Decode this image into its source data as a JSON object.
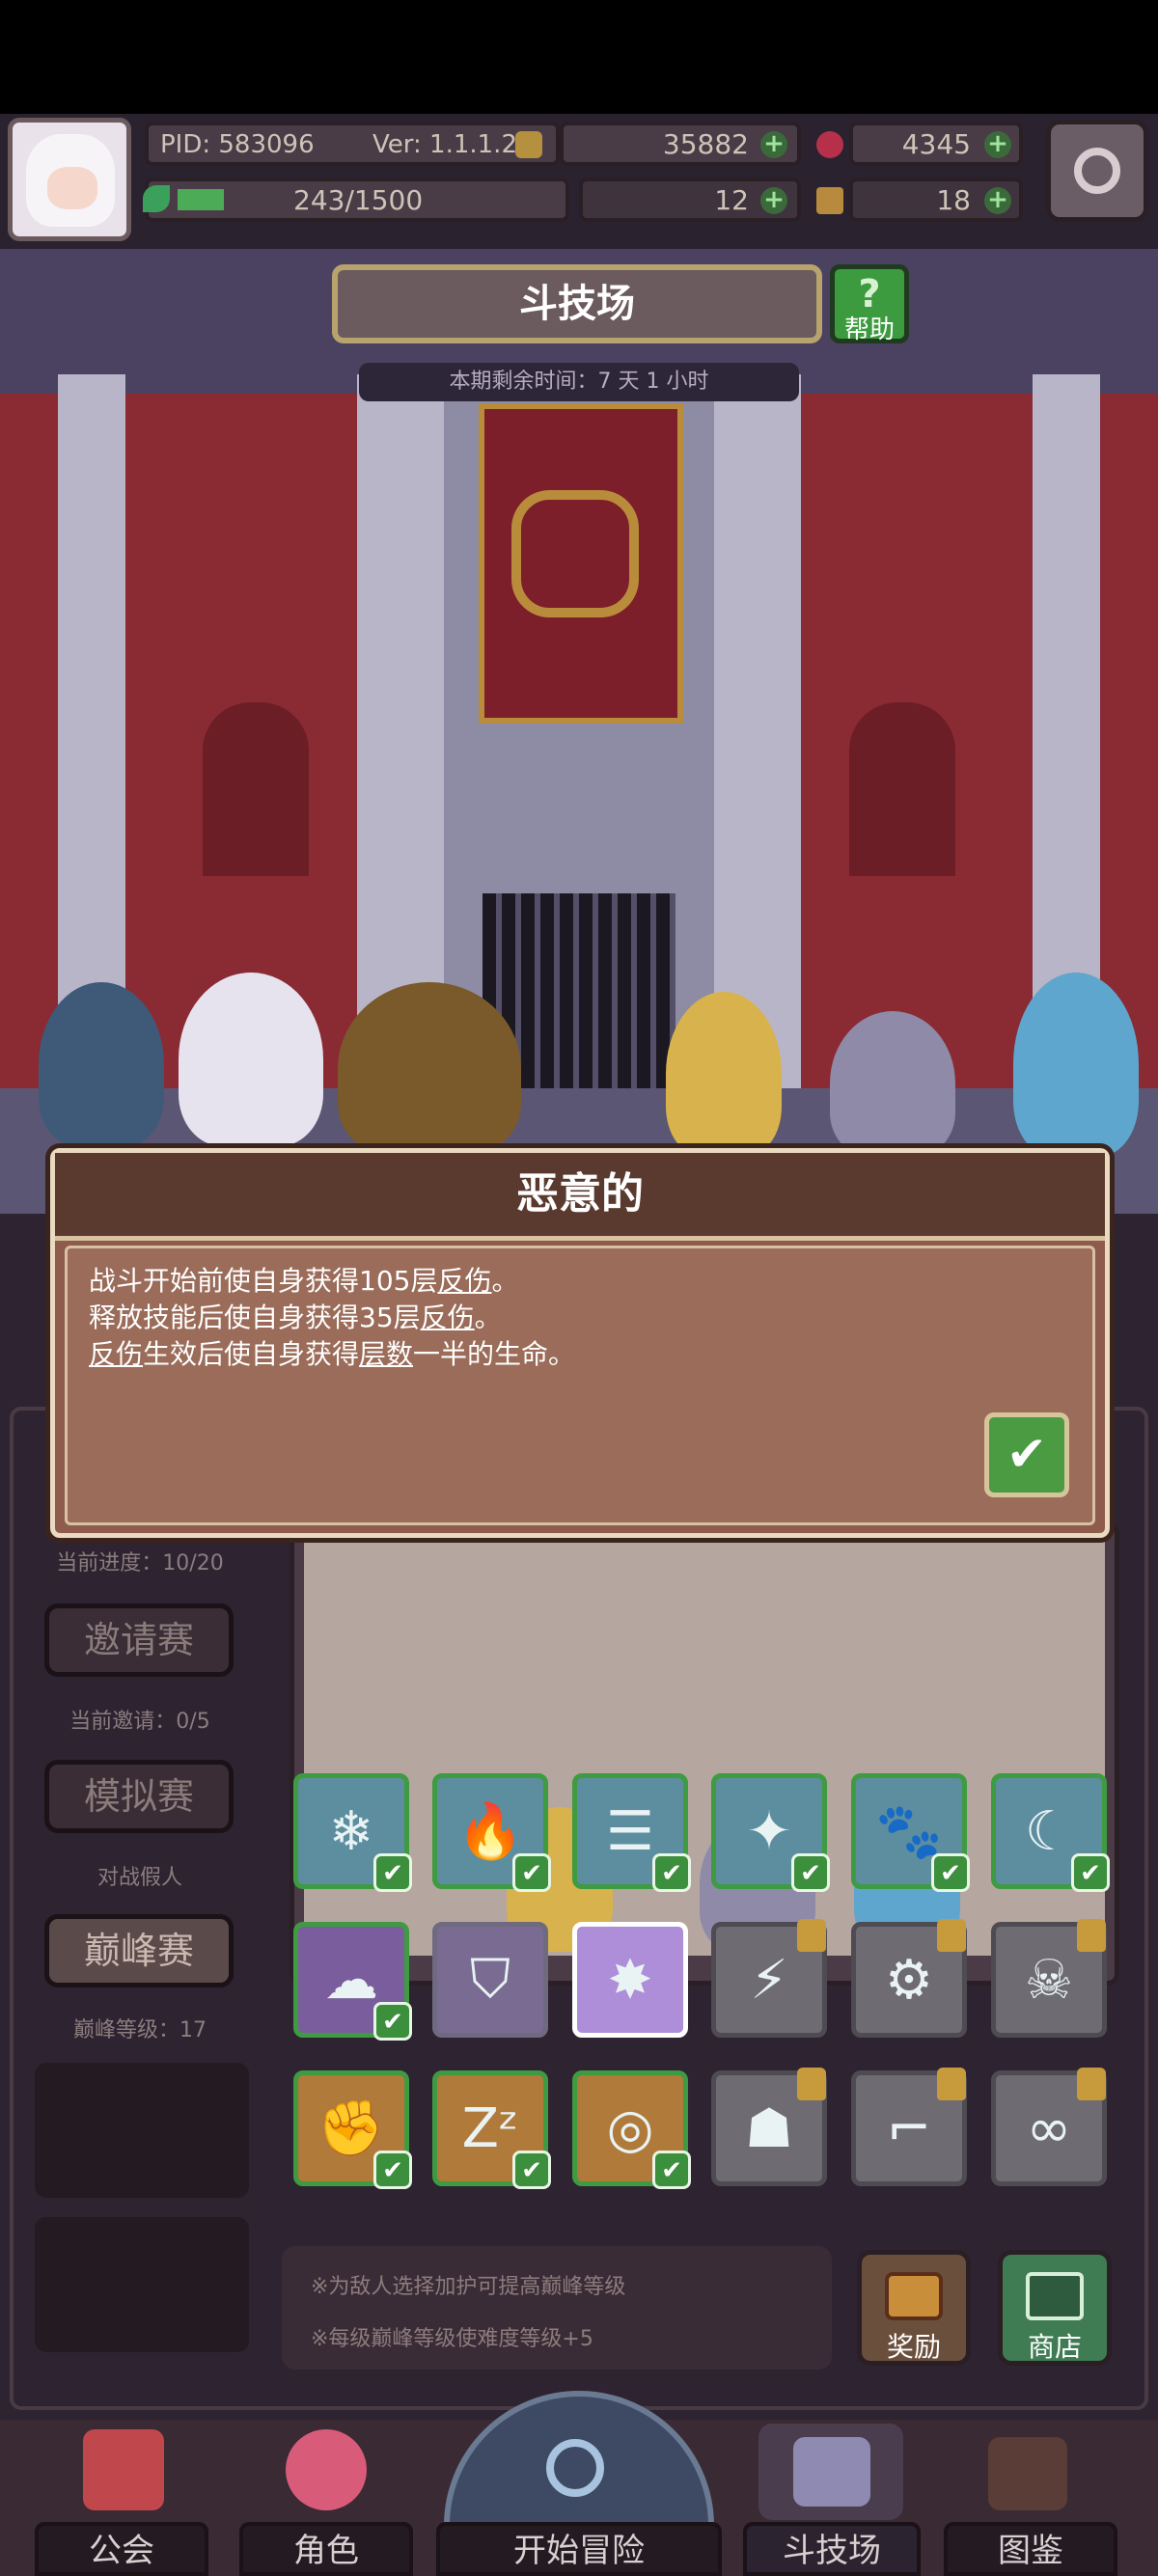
{
  "top_bar": {
    "pid": "PID: 583096",
    "version": "Ver: 1.1.1.2",
    "gold": "35882",
    "gems": "4345",
    "stamina": "243/1500",
    "clover": "12",
    "keys": "18"
  },
  "page": {
    "title": "斗技场",
    "help_label": "帮助",
    "remaining_time": "本期剩余时间：7 天 1 小时"
  },
  "sidebar": {
    "progress_text": "当前进度：10/20",
    "invite_button": "邀请赛",
    "invite_count": "当前邀请：0/5",
    "mock_button": "模拟赛",
    "mock_sub": "对战假人",
    "peak_button": "巅峰赛",
    "peak_level": "巅峰等级：17"
  },
  "tiles": [
    {
      "icon": "snowflake-icon",
      "glyph": "❄",
      "style": "blue",
      "state": "checked"
    },
    {
      "icon": "flame-icon",
      "glyph": "🔥",
      "style": "blue",
      "state": "checked"
    },
    {
      "icon": "funnel-icon",
      "glyph": "☰",
      "style": "blue",
      "state": "checked"
    },
    {
      "icon": "sparkle-icon",
      "glyph": "✦",
      "style": "blue",
      "state": "checked"
    },
    {
      "icon": "paw-icon",
      "glyph": "🐾",
      "style": "blue",
      "state": "checked"
    },
    {
      "icon": "claw-icon",
      "glyph": "☾",
      "style": "blue",
      "state": "checked"
    },
    {
      "icon": "mushroom-cloud-icon",
      "glyph": "☁",
      "style": "purple",
      "state": "checked"
    },
    {
      "icon": "shield-emblem-icon",
      "glyph": "⛉",
      "style": "purple2",
      "state": "none"
    },
    {
      "icon": "burst-icon",
      "glyph": "✸",
      "style": "sel",
      "state": "selected"
    },
    {
      "icon": "lightning-icon",
      "glyph": "⚡",
      "style": "gray",
      "state": "locked"
    },
    {
      "icon": "gear-ring-icon",
      "glyph": "⚙",
      "style": "gray",
      "state": "locked"
    },
    {
      "icon": "skull-icon",
      "glyph": "☠",
      "style": "gray",
      "state": "locked"
    },
    {
      "icon": "fist-icon",
      "glyph": "✊",
      "style": "orange",
      "state": "checked"
    },
    {
      "icon": "sleep-icon",
      "glyph": "Zᶻ",
      "style": "orange",
      "state": "checked"
    },
    {
      "icon": "ripple-icon",
      "glyph": "◎",
      "style": "orange",
      "state": "checked"
    },
    {
      "icon": "ghost-icon",
      "glyph": "☗",
      "style": "gray",
      "state": "locked"
    },
    {
      "icon": "scythe-icon",
      "glyph": "⌐",
      "style": "gray",
      "state": "locked"
    },
    {
      "icon": "infinity-icon",
      "glyph": "∞",
      "style": "gray",
      "state": "locked"
    }
  ],
  "info": {
    "note_1": "※为敌人选择加护可提高巅峰等级",
    "note_2": "※每级巅峰等级使难度等级+5",
    "reward_label": "奖励",
    "shop_label": "商店"
  },
  "nav": {
    "guild": "公会",
    "character": "角色",
    "start": "开始冒险",
    "arena": "斗技场",
    "codex": "图鉴"
  },
  "dialog": {
    "title": "恶意的",
    "line1_prefix": "战斗开始前使自身获得105层",
    "line1_term": "反伤",
    "line1_suffix": "。",
    "line2_prefix": "释放技能后使自身获得35层",
    "line2_term": "反伤",
    "line2_suffix": "。",
    "line3_term1": "反伤",
    "line3_mid": "生效后使自身获得",
    "line3_term2": "层数",
    "line3_suffix": "一半的生命。",
    "confirm_icon": "checkmark-icon"
  }
}
